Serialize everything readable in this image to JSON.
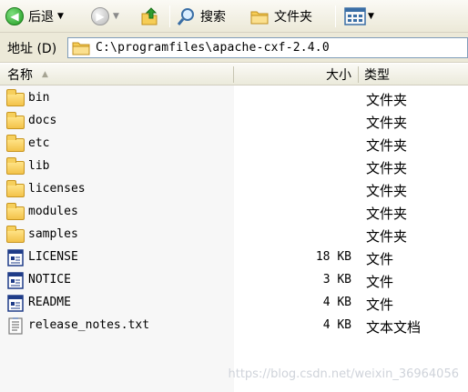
{
  "toolbar": {
    "back_label": "后退",
    "search_label": "搜索",
    "folders_label": "文件夹"
  },
  "address": {
    "label": "地址 (D)",
    "path": "C:\\programfiles\\apache-cxf-2.4.0"
  },
  "columns": {
    "name": "名称",
    "size": "大小",
    "type": "类型"
  },
  "files": [
    {
      "name": "bin",
      "size": "",
      "type": "文件夹",
      "icon": "folder-icon"
    },
    {
      "name": "docs",
      "size": "",
      "type": "文件夹",
      "icon": "folder-icon"
    },
    {
      "name": "etc",
      "size": "",
      "type": "文件夹",
      "icon": "folder-icon"
    },
    {
      "name": "lib",
      "size": "",
      "type": "文件夹",
      "icon": "folder-icon"
    },
    {
      "name": "licenses",
      "size": "",
      "type": "文件夹",
      "icon": "folder-icon"
    },
    {
      "name": "modules",
      "size": "",
      "type": "文件夹",
      "icon": "folder-icon"
    },
    {
      "name": "samples",
      "size": "",
      "type": "文件夹",
      "icon": "folder-icon"
    },
    {
      "name": "LICENSE",
      "size": "18 KB",
      "type": "文件",
      "icon": "file-icon"
    },
    {
      "name": "NOTICE",
      "size": "3 KB",
      "type": "文件",
      "icon": "file-icon"
    },
    {
      "name": "README",
      "size": "4 KB",
      "type": "文件",
      "icon": "file-icon"
    },
    {
      "name": "release_notes.txt",
      "size": "4 KB",
      "type": "文本文档",
      "icon": "text-document-icon"
    }
  ],
  "watermark": "https://blog.csdn.net/weixin_36964056"
}
